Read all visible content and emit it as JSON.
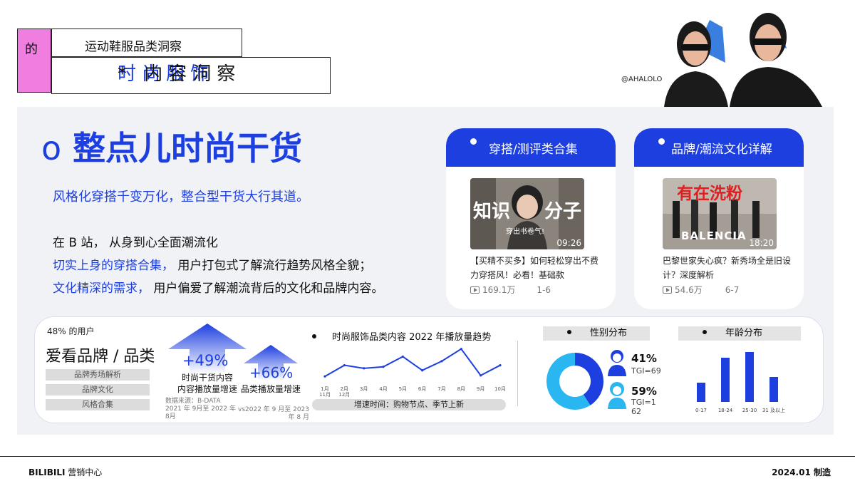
{
  "header": {
    "tag": "的",
    "subtitle": "运动鞋服品类洞察",
    "title_blue": "时尚服饰",
    "title_rest": " * 内容洞察",
    "handle": "@AHALOLO"
  },
  "hero": {
    "bullet": "o",
    "heading": "整点儿时尚干货",
    "lead": "风格化穿搭千变万化，整合型干货大行其道。",
    "line1": "在 B 站， 从身到心全面潮流化",
    "line2_blue": "切实上身的穿搭合集，",
    "line2_rest": " 用户打包式了解流行趋势风格全貌；",
    "line3_blue": "文化精深的需求，",
    "line3_rest": " 用户偏爱了解潮流背后的文化和品牌内容。"
  },
  "cards": [
    {
      "title": "穿搭/测评类合集",
      "thumb_text_left": "知识",
      "thumb_text_right": "分子",
      "thumb_sub": "穿出书卷气!",
      "duration": "09:26",
      "text": "【买精不买多】如何轻松穿出不费力穿搭风！必看！基础款",
      "views": "169.1万",
      "episodes": "1-6"
    },
    {
      "title": "品牌/潮流文化详解",
      "thumb_text_top": "有在洗粉",
      "thumb_text_bottom": "BALENCIA",
      "duration": "18:20",
      "text": "巴黎世家失心疯？新秀场全是旧设计？深度解析",
      "views": "54.6万",
      "episodes": "6-7"
    }
  ],
  "stats": {
    "users_prefix": "48% 的用户",
    "users_heading": "爱看品牌 / 品类",
    "tags": [
      "品牌秀场解析",
      "品牌文化",
      "风格合集"
    ],
    "growth1_value": "+49%",
    "growth1_caption": "时尚干货内容\n内容播放量增速",
    "growth1_source": "数据来源：B-DATA\n2021 年 9月至 2022 年\n8月",
    "growth2_value": "+66%",
    "growth2_caption": "品类播放量增速",
    "growth2_source": "vs2022 年 9 月至 2023\n年 8 月",
    "trend_title": "时尚服饰品类内容 2022 年播放量趋势",
    "trend_note": "增速时间：购物节点、季节上新",
    "gender_title": "性别分布",
    "male_pct": "41%",
    "male_tgi": "TGI=69",
    "female_pct": "59%",
    "female_tgi": "TGI=162",
    "age_title": "年龄分布"
  },
  "chart_data": [
    {
      "type": "line",
      "title": "时尚服饰品类内容 2022 年播放量趋势",
      "x": [
        "1月",
        "2月",
        "3月",
        "4月",
        "5月",
        "6月",
        "7月",
        "8月",
        "9月",
        "10月"
      ],
      "x_sub": [
        "11月",
        "12月"
      ],
      "values": [
        8,
        30,
        24,
        27,
        47,
        20,
        38,
        62,
        10,
        30
      ],
      "color": "#1d3fe0"
    },
    {
      "type": "pie",
      "title": "性别分布",
      "slices": [
        {
          "label": "男",
          "value": 41,
          "color": "#1d3fe0"
        },
        {
          "label": "女",
          "value": 59,
          "color": "#2ab6f0"
        }
      ]
    },
    {
      "type": "bar",
      "title": "年龄分布",
      "categories": [
        "0-17",
        "18-24",
        "25-30",
        "31 及以上"
      ],
      "values": [
        27,
        62,
        70,
        35
      ],
      "color": "#1d3fe0"
    }
  ],
  "footer": {
    "left_bold": "BILIBILI",
    "left_rest": " 营销中心",
    "right": "2024.01 制造"
  },
  "colors": {
    "accent": "#1d3fe0",
    "pink": "#f07ee0",
    "cyan": "#2ab6f0"
  }
}
